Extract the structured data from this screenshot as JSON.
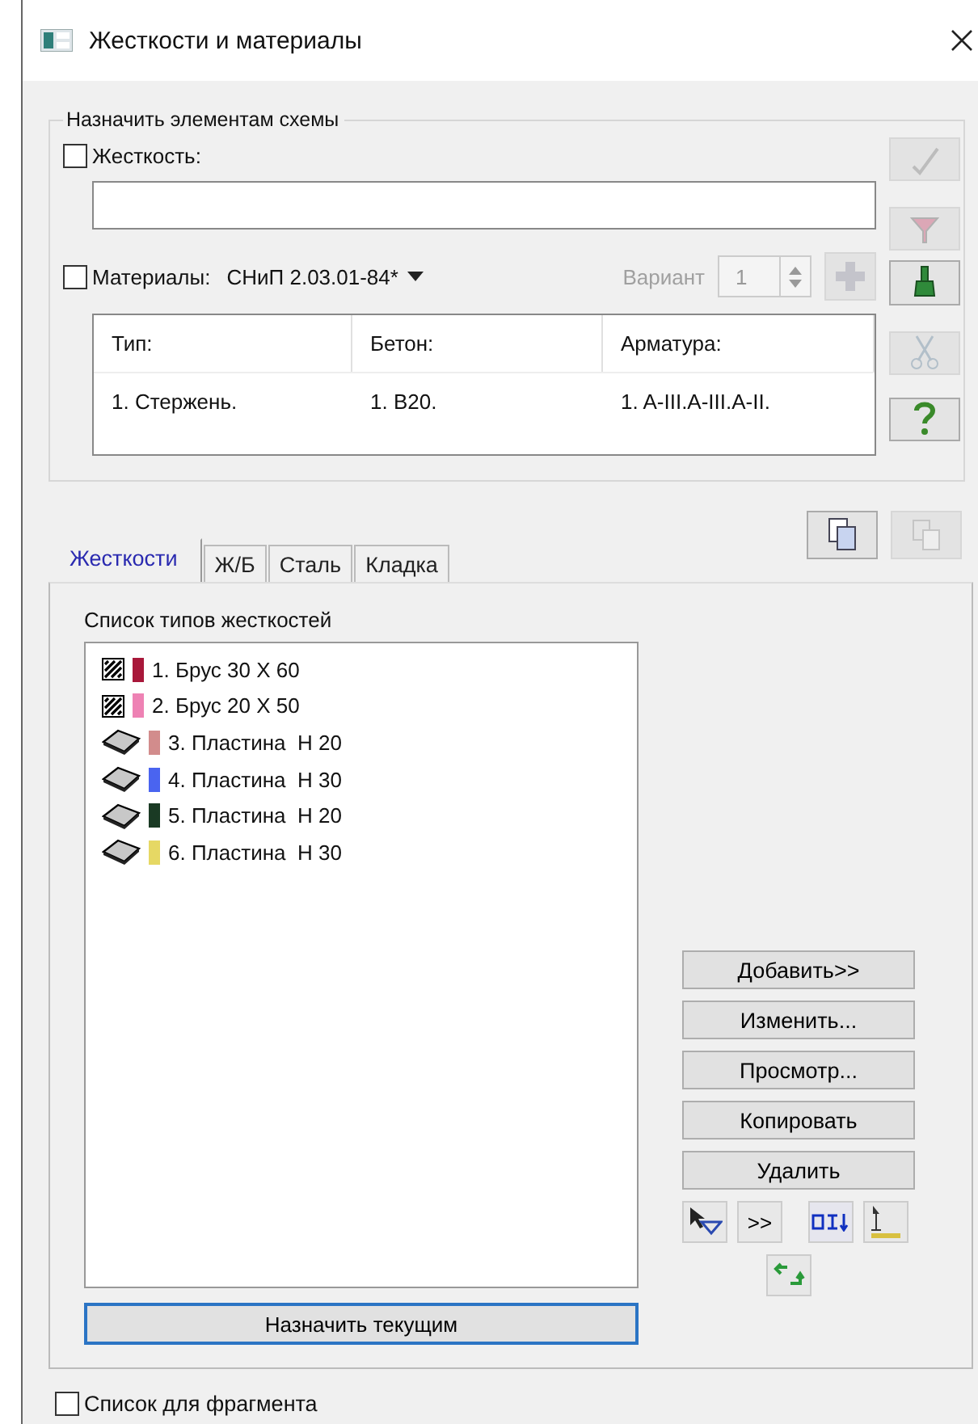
{
  "window": {
    "title": "Жесткости и материалы"
  },
  "assign_group": {
    "legend": "Назначить элементам схемы",
    "stiffness": {
      "label": "Жесткость:",
      "checked": false
    },
    "materials": {
      "label": "Материалы:",
      "checked": false,
      "norm": "СНиП 2.03.01-84*",
      "variant_label": "Вариант",
      "variant_value": "1",
      "variant_disabled": true,
      "plus_disabled": true
    },
    "table": {
      "columns": [
        "Тип:",
        "Бетон:",
        "Арматура:"
      ],
      "rows": [
        [
          "1. Стержень.",
          "1. B20.",
          "1. A-III.A-III.A-II."
        ]
      ]
    },
    "side_tools": [
      {
        "kind": "check",
        "disabled": true
      },
      {
        "kind": "filter",
        "disabled": true
      },
      {
        "kind": "brush",
        "disabled": false
      },
      {
        "kind": "scissors",
        "disabled": true
      },
      {
        "kind": "help",
        "disabled": false
      }
    ]
  },
  "copy_tools": [
    {
      "kind": "copy",
      "disabled": false
    },
    {
      "kind": "paste",
      "disabled": true
    }
  ],
  "tabs": [
    {
      "label": "Жесткости",
      "selected": true
    },
    {
      "label": "Ж/Б",
      "selected": false
    },
    {
      "label": "Сталь",
      "selected": false
    },
    {
      "label": "Кладка",
      "selected": false
    }
  ],
  "list_label": "Список типов жесткостей",
  "stiffness_types": [
    {
      "kind": "beam",
      "color": "#a8183a",
      "label": "1. Брус 30 X 60"
    },
    {
      "kind": "beam",
      "color": "#ee82b4",
      "label": "2. Брус 20 X 50"
    },
    {
      "kind": "plate",
      "color": "#d28c8c",
      "label": "3. Пластина  Н 20"
    },
    {
      "kind": "plate",
      "color": "#4a64f0",
      "label": "4. Пластина  Н 30"
    },
    {
      "kind": "plate",
      "color": "#1a3a24",
      "label": "5. Пластина  Н 20"
    },
    {
      "kind": "plate",
      "color": "#e6d864",
      "label": "6. Пластина  Н 30"
    }
  ],
  "buttons": [
    "Добавить>>",
    "Изменить...",
    "Просмотр...",
    "Копировать",
    "Удалить"
  ],
  "small_tools": [
    {
      "kind": "pointer-filter"
    },
    {
      "kind": "text",
      "label": ">>"
    },
    {
      "kind": "columns"
    },
    {
      "kind": "axis"
    }
  ],
  "swap_tool": {
    "kind": "swap"
  },
  "assign_button": "Назначить текущим",
  "fragment": {
    "label": "Список для фрагмента",
    "checked": false
  }
}
